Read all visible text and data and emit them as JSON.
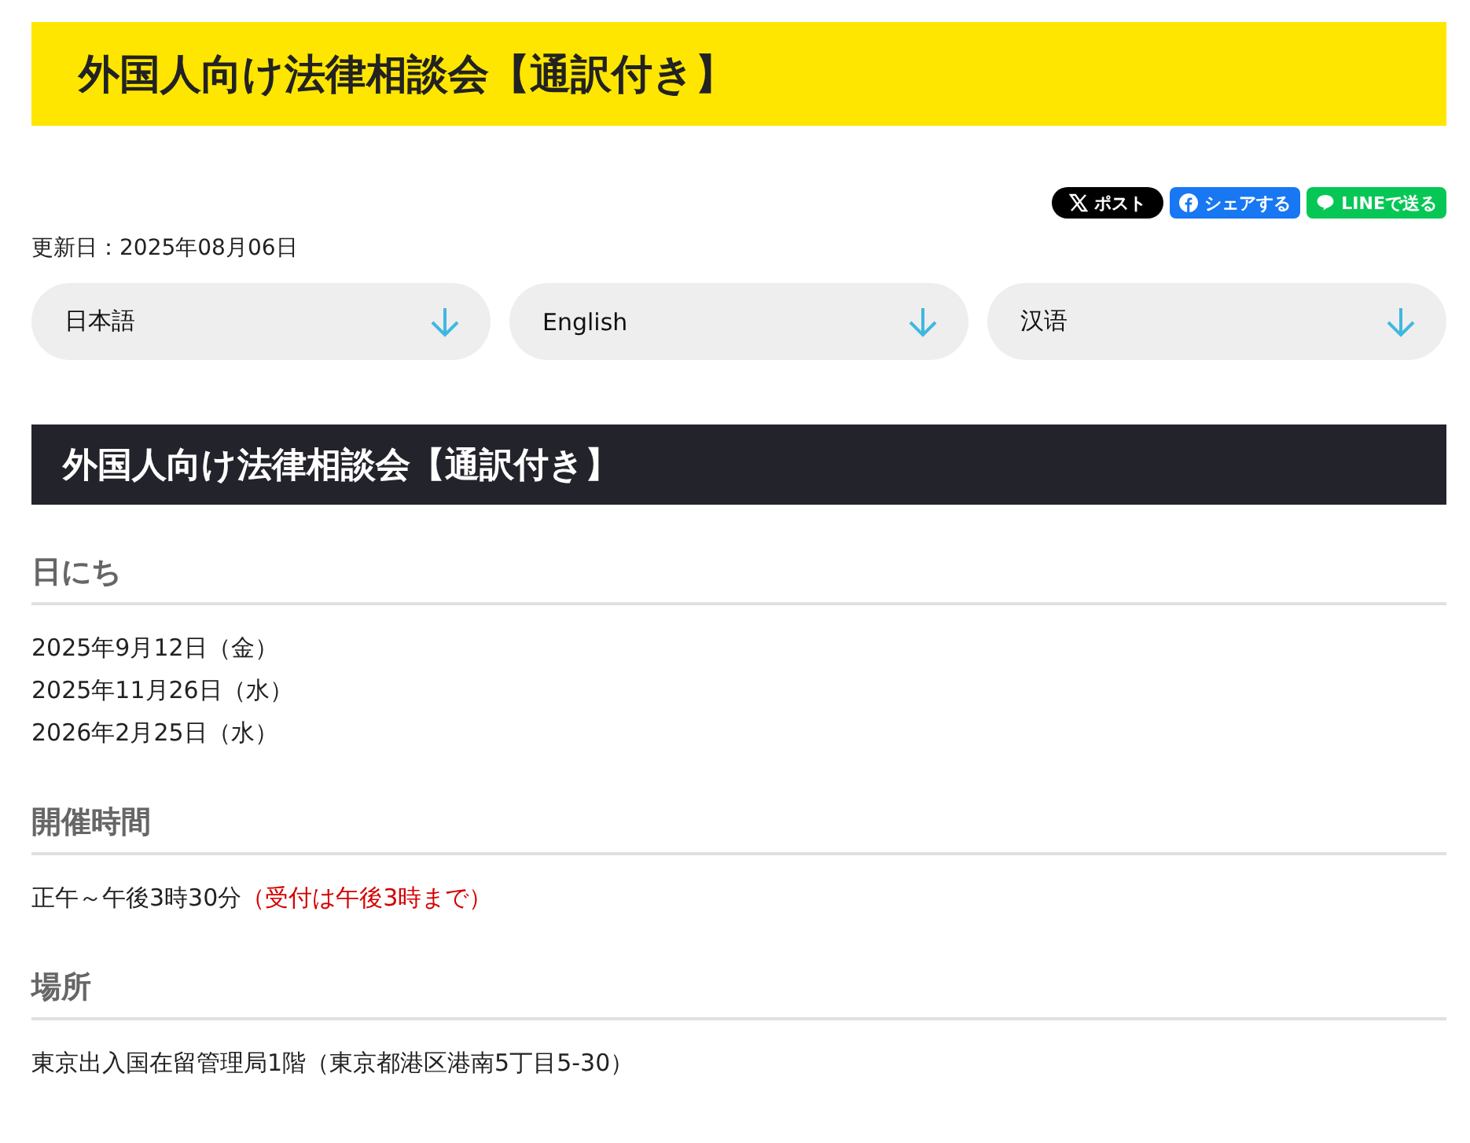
{
  "page_title": "外国人向け法律相談会【通訳付き】",
  "share_buttons": [
    {
      "kind": "x",
      "label": "ポスト"
    },
    {
      "kind": "facebook",
      "label": "シェアする"
    },
    {
      "kind": "line",
      "label": "LINEで送る"
    }
  ],
  "updated": "更新日：2025年08月06日",
  "language_links": [
    {
      "label": "日本語"
    },
    {
      "label": "English"
    },
    {
      "label": "汉语"
    }
  ],
  "article_heading": "外国人向け法律相談会【通訳付き】",
  "sections": [
    {
      "heading": "日にち",
      "lines": [
        {
          "text": "2025年9月12日（金）"
        },
        {
          "text": "2025年11月26日（水）"
        },
        {
          "text": "2026年2月25日（水）"
        }
      ]
    },
    {
      "heading": "開催時間",
      "lines": [
        {
          "text": "正午～午後3時30分",
          "note": "（受付は午後3時まで）"
        }
      ]
    },
    {
      "heading": "場所",
      "lines": [
        {
          "text": "東京出入国在留管理局1階（東京都港区港南5丁目5-30）"
        }
      ]
    }
  ]
}
